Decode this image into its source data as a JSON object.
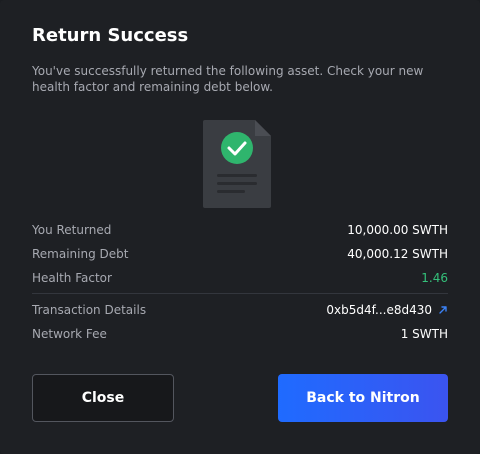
{
  "modal": {
    "title": "Return Success",
    "description": "You've successfully returned the following asset. Check your new health factor and remaining debt below."
  },
  "details": {
    "returned_label": "You Returned",
    "returned_value": "10,000.00 SWTH",
    "debt_label": "Remaining Debt",
    "debt_value": "40,000.12 SWTH",
    "health_label": "Health Factor",
    "health_value": "1.46",
    "tx_label": "Transaction Details",
    "tx_value": "0xb5d4f...e8d430",
    "fee_label": "Network Fee",
    "fee_value": "1 SWTH"
  },
  "buttons": {
    "close_label": "Close",
    "primary_label": "Back to Nitron"
  },
  "icons": {
    "document": "document-check-icon",
    "external": "external-link-icon"
  },
  "colors": {
    "background": "#1e2024",
    "health_good": "#34c07a",
    "accent_check": "#2fb56d",
    "primary_start": "#1f6bff",
    "primary_end": "#3b54f0",
    "link_icon": "#3b82f6"
  }
}
